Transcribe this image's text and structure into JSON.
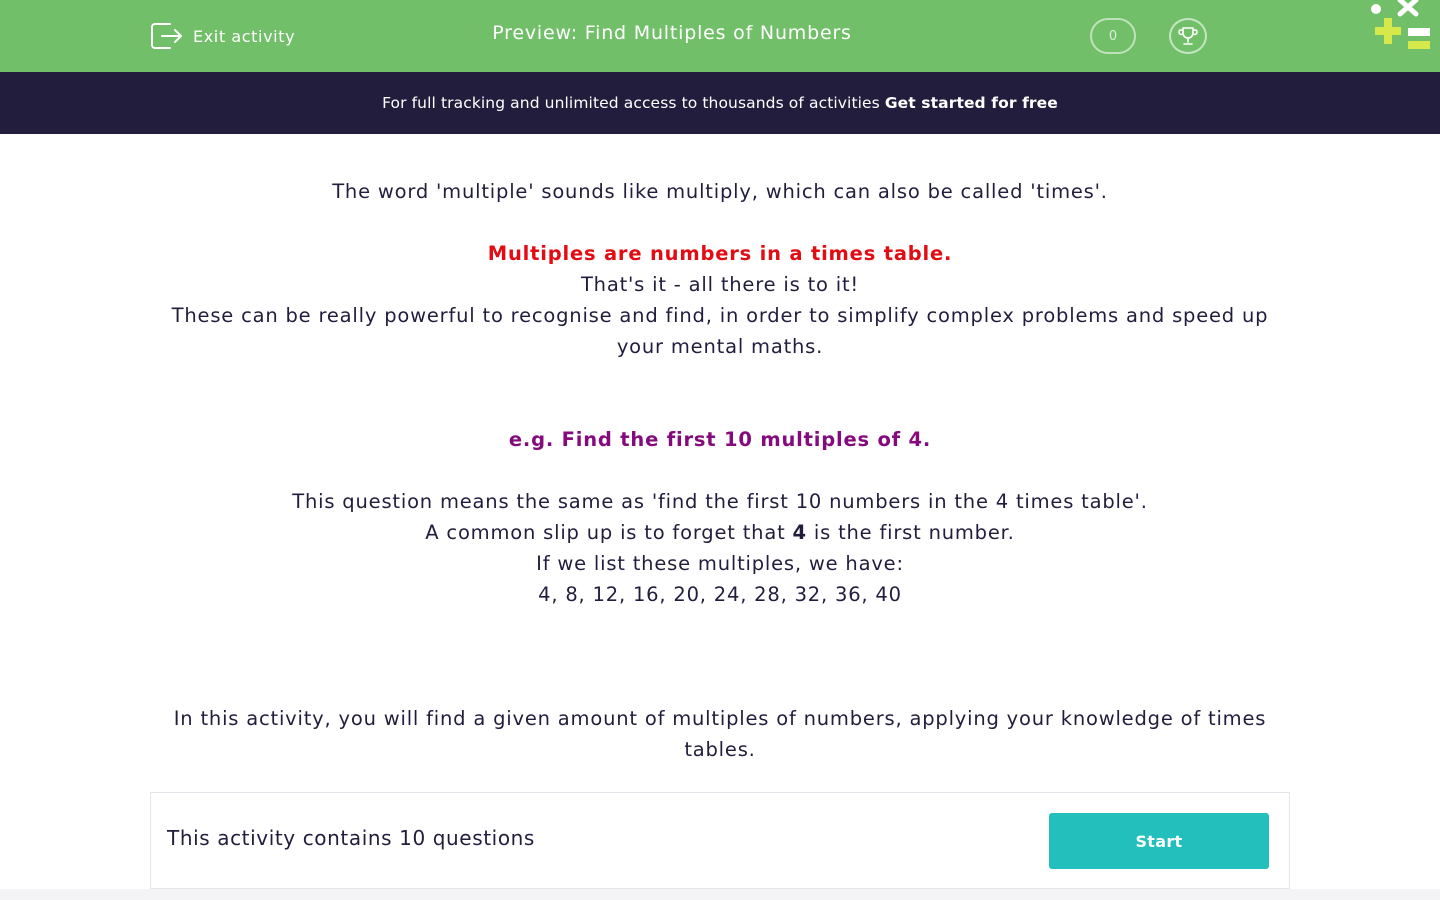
{
  "header": {
    "exit_label": "Exit activity",
    "title": "Preview: Find Multiples of Numbers",
    "score": "0",
    "bg_color": "#72bf6a"
  },
  "banner": {
    "text": "For full tracking and unlimited access to thousands of activities",
    "link": "Get started for free",
    "bg_color": "#231d3d"
  },
  "content": {
    "intro": "The word 'multiple' sounds like multiply, which can also be called 'times'.",
    "definition": "Multiples are numbers in a times table.",
    "thats_it": "That's it - all there is to it!",
    "powerful": "These can be really powerful to recognise and find, in order to simplify complex problems and speed up your mental maths.",
    "example": "e.g. Find the first 10 multiples of 4.",
    "means": "This question means the same as 'find the first 10 numbers in the 4 times table'.",
    "slip_before": "A common slip up is to forget that ",
    "slip_bold": "4",
    "slip_after": " is the first number.",
    "list_intro": "If we list these multiples, we have:",
    "list": "4, 8, 12, 16, 20, 24, 28, 32, 36, 40",
    "activity": "In this activity, you will find a given amount of multiples of numbers, applying your knowledge of times tables."
  },
  "footer": {
    "count_text": "This activity contains 10 questions",
    "start_label": "Start",
    "start_color": "#23bfbd"
  },
  "icons": [
    "exit-icon",
    "trophy-icon",
    "logo-icon"
  ]
}
